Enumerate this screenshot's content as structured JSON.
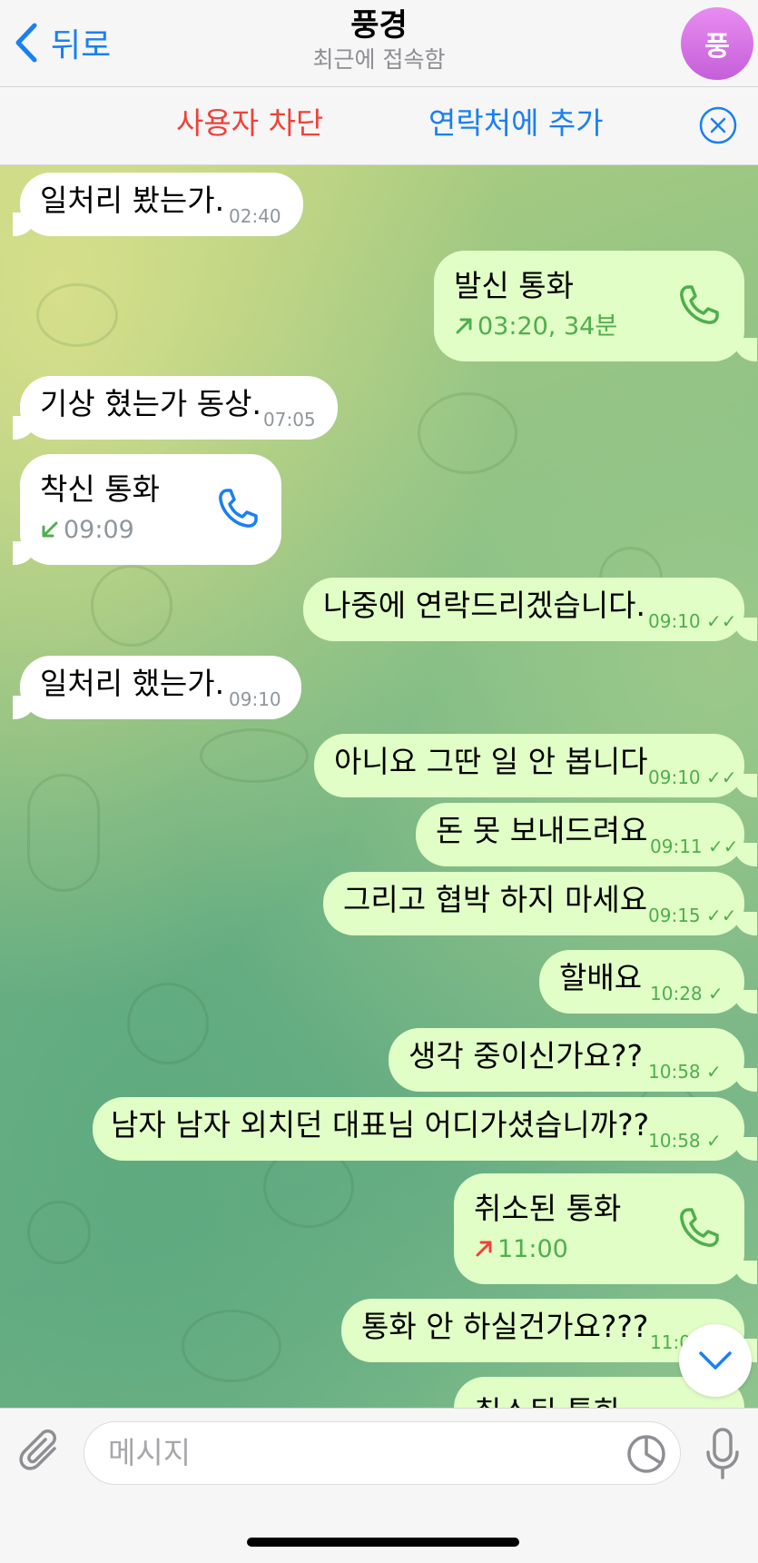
{
  "header": {
    "back_label": "뒤로",
    "title": "풍경",
    "subtitle": "최근에 접속함",
    "avatar_letter": "풍",
    "avatar_color": "#d36ee3"
  },
  "action_bar": {
    "block_label": "사용자 차단",
    "add_label": "연락처에 추가"
  },
  "messages": [
    {
      "dir": "in",
      "text": "일처리 봤는가.",
      "time": "02:40"
    },
    {
      "dir": "out",
      "type": "call",
      "title": "발신 통화",
      "detail": "03:20, 34분",
      "arrow_color": "#4fae4e"
    },
    {
      "dir": "in",
      "text": "기상 혔는가 동상.",
      "time": "07:05"
    },
    {
      "dir": "in",
      "type": "call",
      "title": "착신 통화",
      "detail": "09:09",
      "arrow_color": "#4fae4e"
    },
    {
      "dir": "out",
      "text": "나중에 연락드리겠습니다.",
      "time": "09:10"
    },
    {
      "dir": "in",
      "text": "일처리 했는가.",
      "time": "09:10"
    },
    {
      "dir": "out",
      "text": "아니요 그딴 일 안 봅니다",
      "time": "09:10"
    },
    {
      "dir": "out",
      "text": "돈 못 보내드려요",
      "time": "09:11"
    },
    {
      "dir": "out",
      "text": "그리고 협박 하지 마세요",
      "time": "09:15"
    },
    {
      "dir": "out",
      "text": "할배요",
      "time": "10:28"
    },
    {
      "dir": "out",
      "text": "생각 중이신가요??",
      "time": "10:58"
    },
    {
      "dir": "out",
      "text": "남자 남자 외치던 대표님 어디가셨습니까??",
      "time": "10:58"
    },
    {
      "dir": "out",
      "type": "call",
      "title": "취소된 통화",
      "detail": "11:00",
      "arrow_color": "#ef4139"
    },
    {
      "dir": "out",
      "text": "통화 안 하실건가요???",
      "time": "11:0"
    },
    {
      "dir": "out",
      "type": "call",
      "title": "취소된 통화",
      "detail": ""
    }
  ],
  "input": {
    "placeholder": "메시지"
  },
  "colors": {
    "accent": "#1a7ff2",
    "danger": "#ef4139",
    "outgoing_bubble": "#e1fec6",
    "incoming_bubble": "#ffffff",
    "read_check": "#4fae4e"
  }
}
